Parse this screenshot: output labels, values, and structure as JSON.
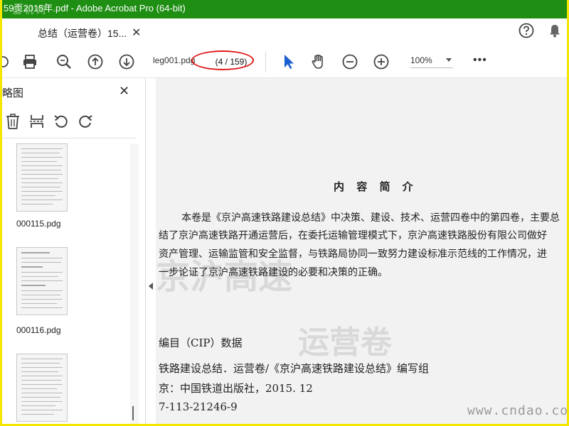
{
  "window": {
    "title": "59页2015年.pdf - Adobe Acrobat Pro (64-bit)",
    "watermark": "值 机 网"
  },
  "tab": {
    "label": "总结（运营卷）15...",
    "close": "✕"
  },
  "toolbar": {
    "filename": "leg001.pdg",
    "page_indicator": "(4 / 159)",
    "zoom": "100%",
    "more": "•••"
  },
  "sidebar": {
    "title": "略图",
    "close": "✕",
    "thumbnails": [
      {
        "label": "000115.pdg"
      },
      {
        "label": "000116.pdg"
      },
      {
        "label": ""
      }
    ]
  },
  "document": {
    "heading": "内 容 简 介",
    "paragraph": [
      "本卷是《京沪高速铁路建设总结》中决策、建设、技术、运营四卷中的第四卷，主要总",
      "结了京沪高速铁路开通运营后，在委托运输管理模式下，京沪高速铁路股份有限公司做好",
      "资产管理、运输监管和安全监督，与铁路局协同一致努力建设标准示范线的工作情况，进",
      "一步论证了京沪高速铁路建设的必要和决策的正确。"
    ],
    "cip_title": "编目（CIP）数据",
    "cip_lines": [
      "铁路建设总结．运营卷/《京沪高速铁路建设总结》编写组",
      "京：中国铁道出版社，2015. 12",
      "7-113-21246-9"
    ],
    "ghost_text_1": "京沪高速",
    "ghost_text_2": "运营卷",
    "site_watermark": "www.cndao.com"
  }
}
